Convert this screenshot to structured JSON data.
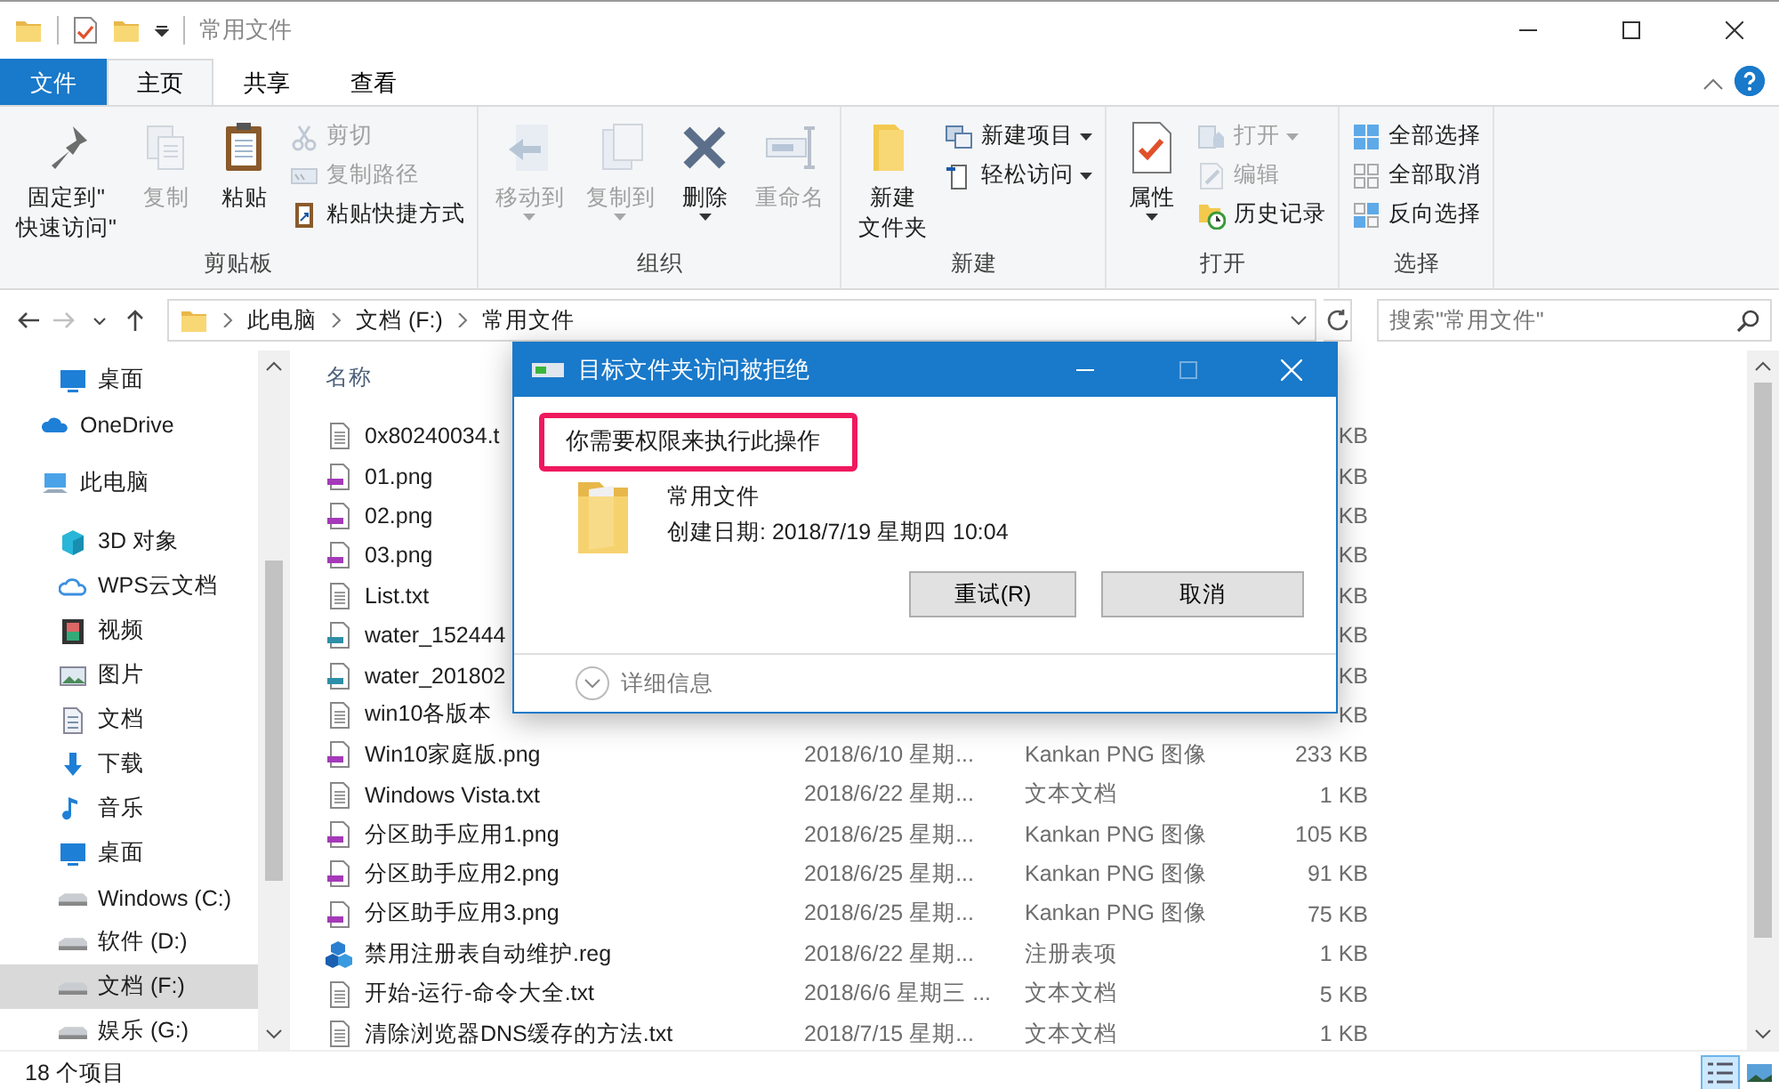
{
  "window": {
    "title": "常用文件"
  },
  "ribbon_tabs": [
    {
      "label": "文件",
      "kind": "file",
      "selected": false
    },
    {
      "label": "主页",
      "kind": "tab",
      "selected": true
    },
    {
      "label": "共享",
      "kind": "tab",
      "selected": false
    },
    {
      "label": "查看",
      "kind": "tab",
      "selected": false
    }
  ],
  "ribbon_groups": [
    {
      "label": "剪贴板",
      "items": [
        {
          "kind": "pin",
          "label": [
            "固定到\"",
            "快速访问\""
          ],
          "disabled": false,
          "dropdown": false
        },
        {
          "kind": "copy",
          "label": "复制",
          "disabled": true,
          "dropdown": false
        },
        {
          "kind": "paste",
          "label": "粘贴",
          "disabled": false,
          "dropdown": false
        },
        {
          "stack": [
            {
              "kind": "cut",
              "label": "剪切",
              "disabled": true,
              "dropdown": false
            },
            {
              "kind": "copypath",
              "label": "复制路径",
              "disabled": true,
              "dropdown": false
            },
            {
              "kind": "pasteshortcut",
              "label": "粘贴快捷方式",
              "disabled": false,
              "dropdown": false
            }
          ]
        }
      ]
    },
    {
      "label": "组织",
      "items": [
        {
          "kind": "moveto",
          "label": "移动到",
          "disabled": true,
          "dropdown": true
        },
        {
          "kind": "copyto",
          "label": "复制到",
          "disabled": true,
          "dropdown": true
        },
        {
          "kind": "delete",
          "label": "删除",
          "disabled": false,
          "dropdown": true
        },
        {
          "kind": "rename",
          "label": "重命名",
          "disabled": true,
          "dropdown": false
        }
      ]
    },
    {
      "label": "新建",
      "items": [
        {
          "kind": "newfolder",
          "label": [
            "新建",
            "文件夹"
          ],
          "disabled": false,
          "dropdown": false
        },
        {
          "stack": [
            {
              "kind": "newitem",
              "label": "新建项目",
              "disabled": false,
              "dropdown": true
            },
            {
              "kind": "easyaccess",
              "label": "轻松访问",
              "disabled": false,
              "dropdown": true
            }
          ]
        }
      ]
    },
    {
      "label": "打开",
      "items": [
        {
          "kind": "properties",
          "label": "属性",
          "disabled": false,
          "dropdown": true
        },
        {
          "stack": [
            {
              "kind": "open",
              "label": "打开",
              "disabled": true,
              "dropdown": true
            },
            {
              "kind": "edit",
              "label": "编辑",
              "disabled": true,
              "dropdown": false
            },
            {
              "kind": "history",
              "label": "历史记录",
              "disabled": false,
              "dropdown": false
            }
          ]
        }
      ]
    },
    {
      "label": "选择",
      "items": [
        {
          "stack": [
            {
              "kind": "selectall",
              "label": "全部选择",
              "disabled": false,
              "dropdown": false
            },
            {
              "kind": "selectnone",
              "label": "全部取消",
              "disabled": false,
              "dropdown": false
            },
            {
              "kind": "invert",
              "label": "反向选择",
              "disabled": false,
              "dropdown": false
            }
          ]
        }
      ]
    }
  ],
  "nav_buttons": [
    {
      "kind": "back",
      "disabled": false
    },
    {
      "kind": "forward",
      "disabled": true
    },
    {
      "kind": "recent",
      "disabled": false
    },
    {
      "kind": "up",
      "disabled": false
    }
  ],
  "breadcrumb": [
    "此电脑",
    "文档 (F:)",
    "常用文件"
  ],
  "search": {
    "placeholder": "搜索\"常用文件\""
  },
  "sidebar": {
    "items": [
      {
        "label": "桌面",
        "kind": "desktop",
        "selected": false
      },
      {
        "label": "OneDrive",
        "kind": "cloud",
        "selected": false
      },
      {
        "label": "此电脑",
        "kind": "pc",
        "selected": false,
        "children": [
          {
            "label": "3D 对象",
            "kind": "cube",
            "selected": false
          },
          {
            "label": "WPS云文档",
            "kind": "cloud-outline",
            "selected": false
          },
          {
            "label": "视频",
            "kind": "video",
            "selected": false
          },
          {
            "label": "图片",
            "kind": "pictures",
            "selected": false
          },
          {
            "label": "文档",
            "kind": "documents",
            "selected": false
          },
          {
            "label": "下载",
            "kind": "download",
            "selected": false
          },
          {
            "label": "音乐",
            "kind": "music",
            "selected": false
          },
          {
            "label": "桌面",
            "kind": "desktop",
            "selected": false
          },
          {
            "label": "Windows (C:)",
            "kind": "drive",
            "selected": false
          },
          {
            "label": "软件 (D:)",
            "kind": "drive",
            "selected": false
          },
          {
            "label": "文档 (F:)",
            "kind": "drive",
            "selected": true
          },
          {
            "label": "娱乐 (G:)",
            "kind": "drive",
            "selected": false
          }
        ]
      }
    ]
  },
  "file_list": {
    "columns": [
      "名称"
    ],
    "rows": [
      {
        "name": "0x80240034.t",
        "size": "KB",
        "kind": "txt"
      },
      {
        "name": "01.png",
        "size": "KB",
        "kind": "png"
      },
      {
        "name": "02.png",
        "size": "KB",
        "kind": "png"
      },
      {
        "name": "03.png",
        "size": "KB",
        "kind": "png"
      },
      {
        "name": "List.txt",
        "size": "KB",
        "kind": "txt"
      },
      {
        "name": "water_152444",
        "size": "KB",
        "kind": "img"
      },
      {
        "name": "water_201802",
        "size": "KB",
        "kind": "img"
      },
      {
        "name": "win10各版本",
        "size": "KB",
        "kind": "txt"
      },
      {
        "name": "Win10家庭版.png",
        "date": "2018/6/10 星期...",
        "type": "Kankan PNG 图像",
        "size": "233 KB",
        "kind": "png"
      },
      {
        "name": "Windows Vista.txt",
        "date": "2018/6/22 星期...",
        "type": "文本文档",
        "size": "1 KB",
        "kind": "txt"
      },
      {
        "name": "分区助手应用1.png",
        "date": "2018/6/25 星期...",
        "type": "Kankan PNG 图像",
        "size": "105 KB",
        "kind": "png"
      },
      {
        "name": "分区助手应用2.png",
        "date": "2018/6/25 星期...",
        "type": "Kankan PNG 图像",
        "size": "91 KB",
        "kind": "png"
      },
      {
        "name": "分区助手应用3.png",
        "date": "2018/6/25 星期...",
        "type": "Kankan PNG 图像",
        "size": "75 KB",
        "kind": "png"
      },
      {
        "name": "禁用注册表自动维护.reg",
        "date": "2018/6/22 星期...",
        "type": "注册表项",
        "size": "1 KB",
        "kind": "reg"
      },
      {
        "name": "开始-运行-命令大全.txt",
        "date": "2018/6/6 星期三 ...",
        "type": "文本文档",
        "size": "5 KB",
        "kind": "txt"
      },
      {
        "name": "清除浏览器DNS缓存的方法.txt",
        "date": "2018/7/15 星期...",
        "type": "文本文档",
        "size": "1 KB",
        "kind": "txt"
      }
    ]
  },
  "status_bar": {
    "count": "18 个项目",
    "views": [
      {
        "kind": "details",
        "selected": true
      },
      {
        "kind": "tiles",
        "selected": false
      }
    ]
  },
  "dialog": {
    "title": "目标文件夹访问被拒绝",
    "message": "你需要权限来执行此操作",
    "highlighted": true,
    "item_name": "常用文件",
    "item_date": "创建日期: 2018/7/19 星期四 10:04",
    "buttons": [
      "重试(R)",
      "取消"
    ],
    "details": "详细信息"
  }
}
